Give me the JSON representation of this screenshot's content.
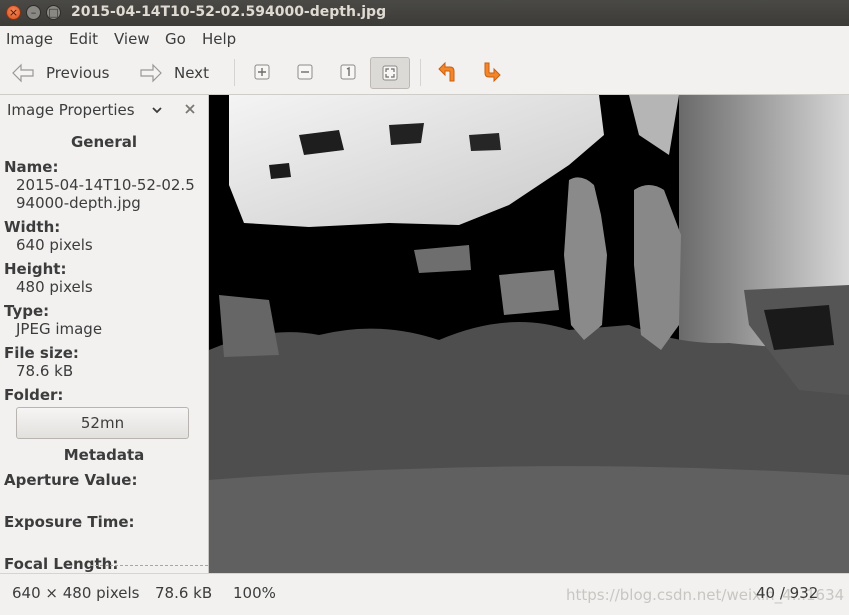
{
  "window": {
    "title": "2015-04-14T10-52-02.594000-depth.jpg",
    "controls": {
      "close": "×",
      "minimize": "–",
      "maximize": "□"
    }
  },
  "menubar": {
    "items": [
      "Image",
      "Edit",
      "View",
      "Go",
      "Help"
    ]
  },
  "toolbar": {
    "previous_label": "Previous",
    "next_label": "Next",
    "icons": [
      "zoom-in-icon",
      "zoom-out-icon",
      "normal-size-icon",
      "best-fit-icon",
      "rotate-left-icon",
      "rotate-right-icon"
    ],
    "rotate_color": "#f07a1a"
  },
  "sidebar": {
    "title": "Image Properties",
    "sections": {
      "general": "General",
      "metadata": "Metadata"
    },
    "props": {
      "name_label": "Name:",
      "name_line1": "2015-04-14T10-52-02.5",
      "name_line2": "94000-depth.jpg",
      "width_label": "Width:",
      "width_value": "640 pixels",
      "height_label": "Height:",
      "height_value": "480 pixels",
      "type_label": "Type:",
      "type_value": "JPEG image",
      "filesize_label": "File size:",
      "filesize_value": "78.6 kB",
      "folder_label": "Folder:",
      "folder_value": "52mn"
    },
    "metadata": {
      "aperture_label": "Aperture Value:",
      "exposure_label": "Exposure Time:",
      "focal_label": "Focal Length:"
    }
  },
  "statusbar": {
    "dimensions": "640 × 480 pixels",
    "size": "78.6 kB",
    "zoom": "100%",
    "position": "40 / 932",
    "watermark": "https://blog.csdn.net/weixin_4...1634"
  }
}
